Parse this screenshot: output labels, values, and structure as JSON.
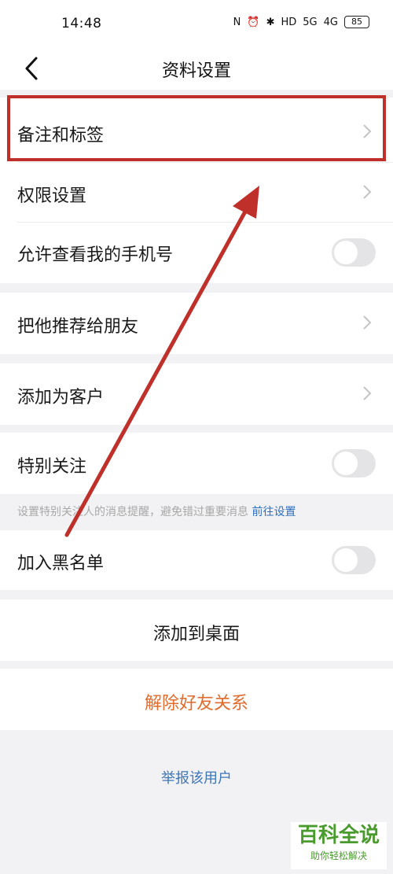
{
  "status": {
    "time": "14:48",
    "icons": [
      "N",
      "⏰",
      "✱",
      "HD",
      "5G",
      "4G"
    ],
    "battery": "85"
  },
  "header": {
    "title": "资料设置"
  },
  "rows": {
    "remark": "备注和标签",
    "permission": "权限设置",
    "allow_phone": "允许查看我的手机号",
    "recommend": "把他推荐给朋友",
    "add_customer": "添加为客户",
    "special_follow": "特别关注",
    "blacklist": "加入黑名单",
    "add_desktop": "添加到桌面",
    "unfriend": "解除好友关系",
    "report": "举报该用户"
  },
  "hint": {
    "text": "设置特别关注人的消息提醒，避免错过重要消息",
    "link": "前往设置"
  },
  "toggles": {
    "allow_phone": false,
    "special_follow": false,
    "blacklist": false
  },
  "watermark": {
    "title": "百科全说",
    "subtitle": "助你轻松解决"
  },
  "colors": {
    "accent_red": "#c0302a",
    "danger_orange": "#e06b2c",
    "link_blue": "#2b6fbf"
  }
}
